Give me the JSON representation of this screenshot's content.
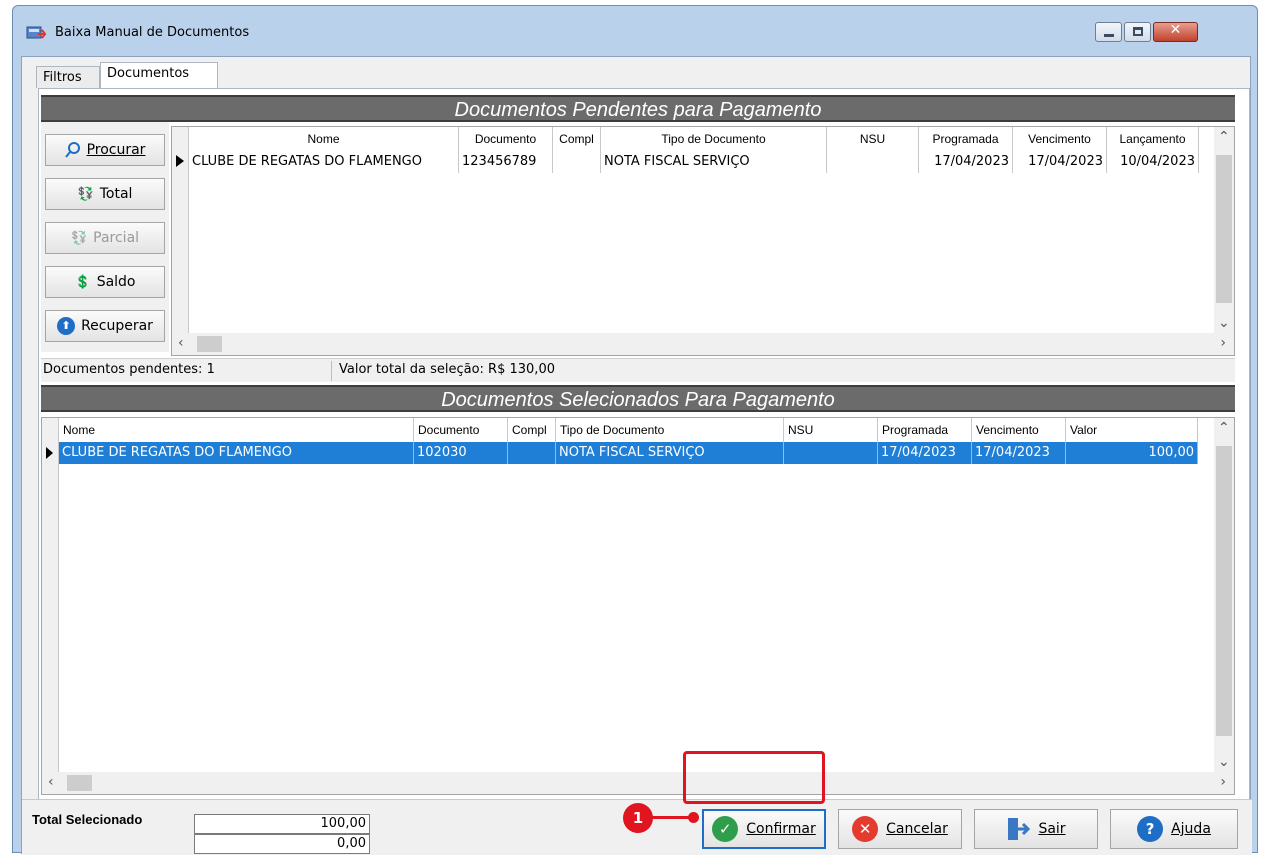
{
  "window": {
    "title": "Baixa Manual de Documentos",
    "close_glyph": "✕"
  },
  "tabs": [
    "Filtros",
    "Documentos"
  ],
  "pending": {
    "header": "Documentos Pendentes para Pagamento",
    "buttons": [
      {
        "label": "Procurar",
        "icon": "search-icon",
        "glyph": "⚲"
      },
      {
        "label": "Total",
        "icon": "money-add-icon",
        "glyph": "💱"
      },
      {
        "label": "Parcial",
        "icon": "money-partial-icon",
        "glyph": "💱"
      },
      {
        "label": "Saldo",
        "icon": "balance-icon",
        "glyph": "💲"
      },
      {
        "label": "Recuperar",
        "icon": "recover-icon",
        "glyph": "⬆"
      }
    ],
    "columns": [
      "Nome",
      "Documento",
      "Compl",
      "Tipo de Documento",
      "NSU",
      "Programada",
      "Vencimento",
      "Lançamento"
    ],
    "rows": [
      [
        "CLUBE DE REGATAS DO FLAMENGO",
        "123456789",
        "",
        "NOTA FISCAL SERVIÇO",
        "",
        "17/04/2023",
        "17/04/2023",
        "10/04/2023"
      ]
    ],
    "status_count": "Documentos pendentes: 1",
    "status_value": "Valor total da seleção: R$ 130,00"
  },
  "selected": {
    "header": "Documentos Selecionados Para Pagamento",
    "columns": [
      "Nome",
      "Documento",
      "Compl",
      "Tipo de Documento",
      "NSU",
      "Programada",
      "Vencimento",
      "Valor"
    ],
    "rows": [
      [
        "CLUBE DE REGATAS DO FLAMENGO",
        "102030",
        "",
        "NOTA FISCAL SERVIÇO",
        "",
        "17/04/2023",
        "17/04/2023",
        "100,00"
      ]
    ]
  },
  "footer": {
    "total_label": "Total Selecionado",
    "total_value_1": "100,00",
    "total_value_2": "0,00",
    "buttons": {
      "confirm": "Confirmar",
      "cancel": "Cancelar",
      "exit": "Sair",
      "help": "Ajuda"
    },
    "callout_number": "1"
  },
  "colors": {
    "selection": "#1f7fd6",
    "header_band": "#6b6b6b",
    "highlight": "#e0151f",
    "confirm_icon": "#2e9e4a",
    "cancel_icon": "#e33b2e",
    "help_icon": "#1e6ec8"
  }
}
